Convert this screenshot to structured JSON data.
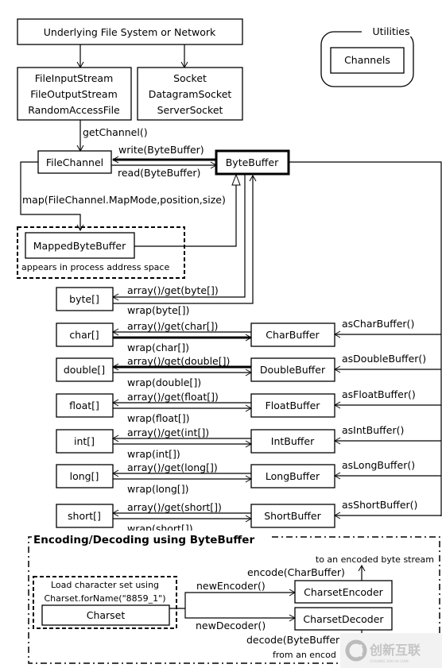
{
  "top": {
    "source": "Underlying File System or Network",
    "file_streams": [
      "FileInputStream",
      "FileOutputStream",
      "RandomAccessFile"
    ],
    "sockets": [
      "Socket",
      "DatagramSocket",
      "ServerSocket"
    ]
  },
  "utilities": {
    "label": "Utilities",
    "item": "Channels"
  },
  "channel": {
    "get_channel": "getChannel()",
    "file_channel": "FileChannel",
    "write": "write(ByteBuffer)",
    "read": "read(ByteBuffer)",
    "byte_buffer": "ByteBuffer",
    "map": "map(FileChannel.MapMode,position,size)",
    "mapped": "MappedByteBuffer",
    "mapped_note": "appears in process address space"
  },
  "rows": [
    {
      "array": "byte[]",
      "get": "array()/get(byte[])",
      "wrap": "wrap(byte[])"
    },
    {
      "array": "char[]",
      "buffer": "CharBuffer",
      "get": "array()/get(char[])",
      "wrap": "wrap(char[])",
      "as": "asCharBuffer()"
    },
    {
      "array": "double[]",
      "buffer": "DoubleBuffer",
      "get": "array()/get(double[])",
      "wrap": "wrap(double[])",
      "as": "asDoubleBuffer()"
    },
    {
      "array": "float[]",
      "buffer": "FloatBuffer",
      "get": "array()/get(float[])",
      "wrap": "wrap(float[])",
      "as": "asFloatBuffer()"
    },
    {
      "array": "int[]",
      "buffer": "IntBuffer",
      "get": "array()/get(int[])",
      "wrap": "wrap(int[])",
      "as": "asIntBuffer()"
    },
    {
      "array": "long[]",
      "buffer": "LongBuffer",
      "get": "array()/get(long[])",
      "wrap": "wrap(long[])",
      "as": "asLongBuffer()"
    },
    {
      "array": "short[]",
      "buffer": "ShortBuffer",
      "get": "array()/get(short[])",
      "wrap": "wrap(short[])",
      "as": "asShortBuffer()"
    }
  ],
  "encoding": {
    "title": "Encoding/Decoding using ByteBuffer",
    "load_note_1": "Load character set using",
    "load_note_2": "Charset.forName(\"8859_1\")",
    "charset": "Charset",
    "new_encoder": "newEncoder()",
    "new_decoder": "newDecoder()",
    "encoder": "CharsetEncoder",
    "decoder": "CharsetDecoder",
    "encode": "encode(CharBuffer)",
    "to_stream": "to an encoded byte stream",
    "decode": "decode(ByteBuffer",
    "from_stream": "from an encod"
  },
  "watermark": {
    "text": "创新互联",
    "subtext": "CHUANG XIN HU LIAN"
  }
}
